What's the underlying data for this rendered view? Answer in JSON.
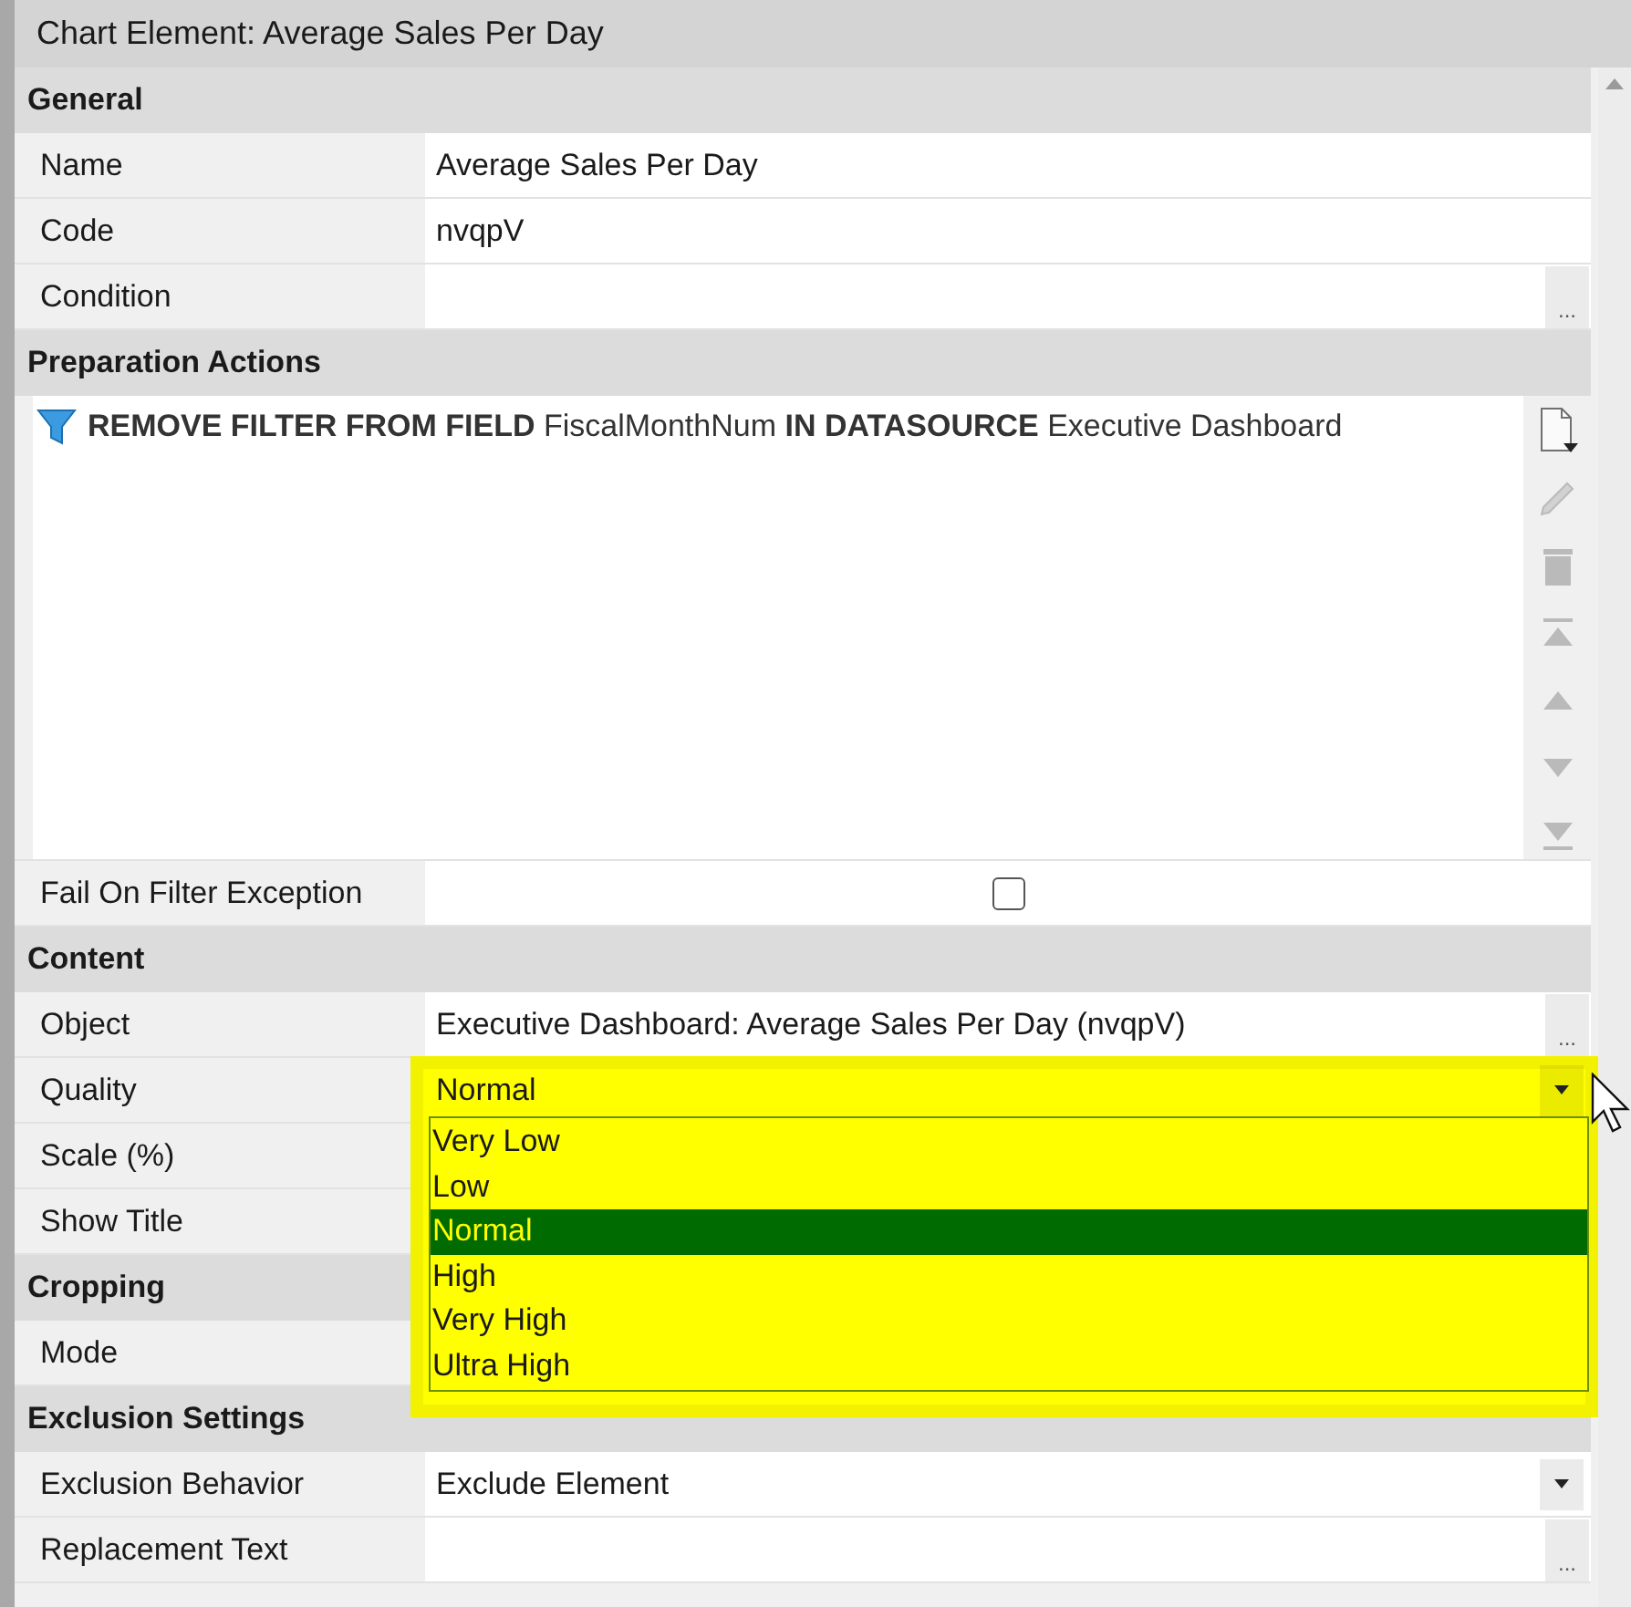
{
  "window": {
    "title": "Chart Element: Average Sales Per Day"
  },
  "sections": [
    {
      "title": "General",
      "kind": "rows",
      "rows": [
        {
          "label": "Name",
          "kind": "text",
          "value": "Average Sales Per Day"
        },
        {
          "label": "Code",
          "kind": "text",
          "value": "nvqpV"
        },
        {
          "label": "Condition",
          "kind": "ellipsis",
          "button": "..."
        }
      ]
    },
    {
      "title": "Preparation Actions",
      "kind": "actions",
      "actions": [
        {
          "text": "**REMOVE FILTER FROM FIELD** FiscalMonthNum **IN DATASOURCE** Executive Dashboard"
        }
      ],
      "tools": [
        {
          "kind": "new",
          "disabled": false
        },
        {
          "kind": "edit",
          "disabled": true
        },
        {
          "kind": "delete",
          "disabled": true
        },
        {
          "kind": "top",
          "disabled": true
        },
        {
          "kind": "up",
          "disabled": true
        },
        {
          "kind": "down",
          "disabled": true
        },
        {
          "kind": "bottom",
          "disabled": true
        }
      ],
      "rows": [
        {
          "label": "Fail On Filter Exception",
          "kind": "checkbox",
          "checked": false
        }
      ]
    },
    {
      "title": "Content",
      "kind": "rows",
      "rows": [
        {
          "label": "Object",
          "kind": "ellipsis",
          "value": "Executive Dashboard: Average Sales Per Day (nvqpV)",
          "button": "..."
        },
        {
          "label": "Quality",
          "kind": "dropdown",
          "value": "Normal",
          "open": true,
          "highlighted": true,
          "options": [
            {
              "label": "Very Low",
              "selected": false
            },
            {
              "label": "Low",
              "selected": false
            },
            {
              "label": "Normal",
              "selected": true
            },
            {
              "label": "High",
              "selected": false
            },
            {
              "label": "Very High",
              "selected": false
            },
            {
              "label": "Ultra High",
              "selected": false
            }
          ]
        },
        {
          "label": "Scale (%)",
          "kind": "text"
        },
        {
          "label": "Show Title",
          "kind": "text"
        }
      ]
    },
    {
      "title": "Cropping",
      "kind": "rows",
      "rows": [
        {
          "label": "Mode",
          "kind": "text"
        }
      ]
    },
    {
      "title": "Exclusion Settings",
      "kind": "rows",
      "rows": [
        {
          "label": "Exclusion Behavior",
          "kind": "dropdown",
          "value": "Exclude Element",
          "open": false
        },
        {
          "label": "Replacement Text",
          "kind": "ellipsis",
          "button": "..."
        }
      ]
    }
  ]
}
